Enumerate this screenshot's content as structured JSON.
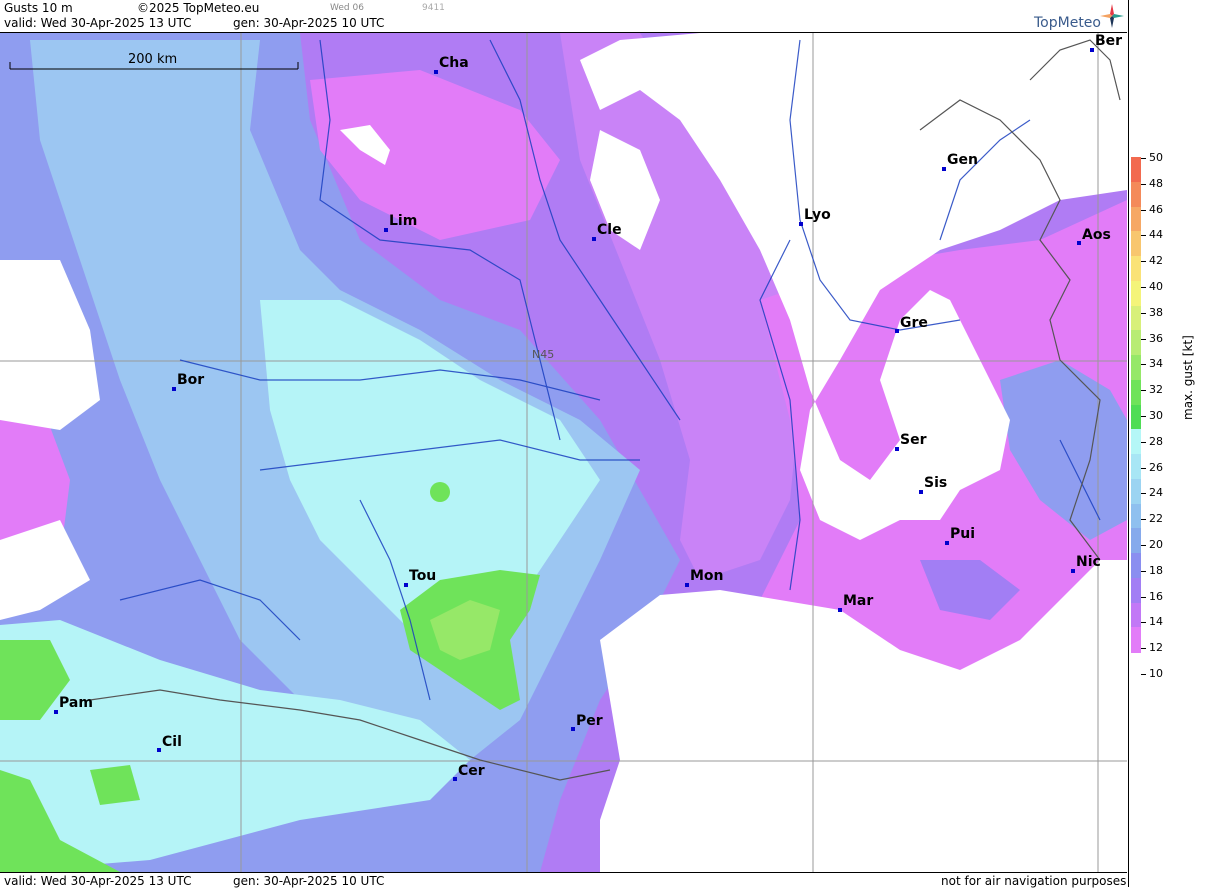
{
  "header": {
    "product": "Gusts 10 m",
    "copyright": "©2025 TopMeteo.eu",
    "day_tag": "Wed 06",
    "code": "9411",
    "valid": "valid:  Wed  30-Apr-2025  13 UTC",
    "gen": "gen: 30-Apr-2025 10 UTC",
    "logo_text": "TopMeteo"
  },
  "footer": {
    "valid": "valid:  Wed  30-Apr-2025  13 UTC",
    "gen": "gen: 30-Apr-2025 10 UTC",
    "disclaimer": "not for air navigation purposes"
  },
  "map": {
    "scale_label": "200 km",
    "lat_label": "N45",
    "cities": [
      "Cha",
      "Ber",
      "Gen",
      "Lim",
      "Cle",
      "Lyo",
      "Aos",
      "Gre",
      "Bor",
      "Ser",
      "Sis",
      "Pui",
      "Tou",
      "Mon",
      "Nic",
      "Mar",
      "Pam",
      "Per",
      "Cil",
      "Cer"
    ]
  },
  "legend": {
    "title": "max. gust  [kt]",
    "ticks": [
      "50",
      "48",
      "46",
      "44",
      "42",
      "40",
      "38",
      "36",
      "34",
      "32",
      "30",
      "28",
      "26",
      "24",
      "22",
      "20",
      "18",
      "16",
      "14",
      "12",
      "10"
    ],
    "colors": [
      "#f26a4f",
      "#f48a5a",
      "#f6a865",
      "#f8c66e",
      "#fae277",
      "#f4f47a",
      "#d8f07a",
      "#b8ec74",
      "#96e868",
      "#6fe35a",
      "#4fdd55",
      "#b5f7f7",
      "#a8e6f5",
      "#9cd4f2",
      "#8fc0ef",
      "#86aaec",
      "#8a8ef0",
      "#a27ef4",
      "#c278f6",
      "#e27cf8"
    ]
  }
}
